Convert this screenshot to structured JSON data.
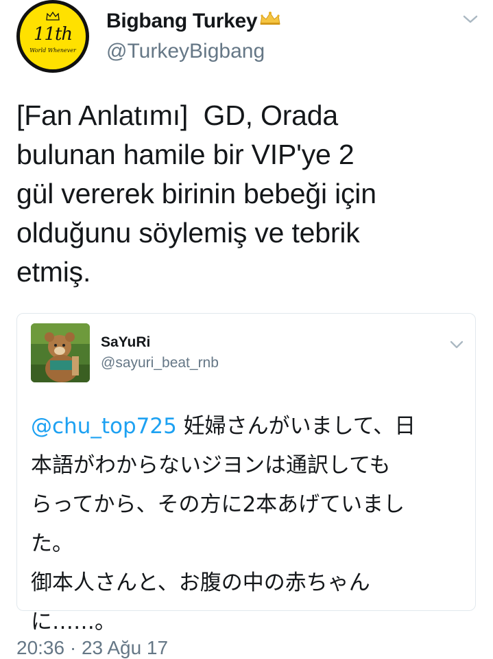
{
  "tweet": {
    "display_name": "Bigbang Turkey",
    "handle": "@TurkeyBigbang",
    "avatar": {
      "text": "11th",
      "subtext": "World Whenever"
    },
    "text": "[Fan Anlatımı]  GD, Orada\nbulunan hamile bir VIP'ye 2\ngül vererek birinin bebeği için\nolduğunu söylemiş ve tebrik\netmiş.",
    "timestamp": "20:36 · 23 Ağu 17"
  },
  "quoted_tweet": {
    "display_name": "SaYuRi",
    "handle": "@sayuri_beat_rnb",
    "mention": "@chu_top725",
    "text": " 妊婦さんがいまして、日\n本語がわからないジヨンは通訳しても\nらってから、その方に2本あげていまし\nた。\n御本人さんと、お腹の中の赤ちゃん\nに……。"
  },
  "icons": {
    "crown": "crown-emoji-icon",
    "chevron": "chevron-down-icon"
  },
  "colors": {
    "link": "#1da1f2",
    "secondary_text": "#657786",
    "primary_text": "#14171a",
    "border": "#e1e8ed",
    "avatar_yellow": "#ffe100"
  }
}
